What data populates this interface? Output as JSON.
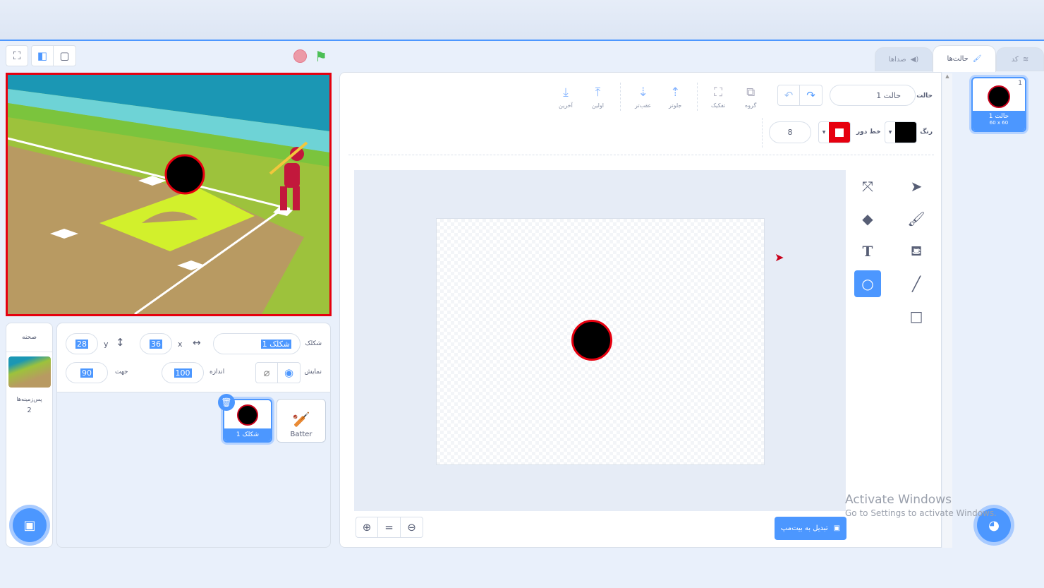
{
  "tabs": {
    "code": "کد",
    "costumes": "حالت‌ها",
    "sounds": "صداها"
  },
  "toolbar": {
    "costume_label": "حالت",
    "costume_name": "حالت 1",
    "group": "گروه",
    "ungroup": "تفکیک",
    "forward": "جلوتر",
    "backward": "عقب‌تر",
    "front": "اولین",
    "back": "آخرین",
    "fill_label": "رنگ",
    "outline_label": "خط دور",
    "outline_width": "8"
  },
  "colors": {
    "fill": "#000000",
    "outline": "#e6000f",
    "accent": "#4c97ff"
  },
  "convert_button": "تبدیل به بیت‌مپ",
  "costume_list": [
    {
      "index": "1",
      "name": "حالت 1",
      "size": "60 x 60"
    }
  ],
  "sprite_info": {
    "sprite_label": "شکلک",
    "sprite_name": "شکلک 1",
    "x_label": "x",
    "x": "36",
    "y_label": "y",
    "y": "28",
    "show_label": "نمایش",
    "size_label": "اندازه",
    "size": "100",
    "direction_label": "جهت",
    "direction": "90"
  },
  "sprites": [
    {
      "name": "شکلک 1",
      "selected": true
    },
    {
      "name": "Batter",
      "selected": false
    }
  ],
  "stage_pane": {
    "title": "صحنه",
    "backdrops_label": "پس‌زمینه‌ها",
    "backdrops_count": "2"
  },
  "watermark": {
    "line1": "Activate Windows",
    "line2": "Go to Settings to activate Windows."
  }
}
